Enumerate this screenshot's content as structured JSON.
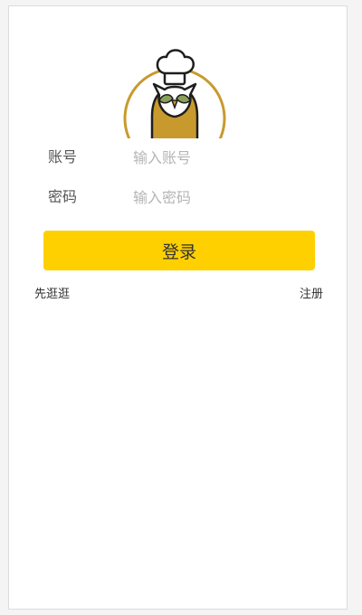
{
  "logo": {
    "icon": "chef-owl-logo",
    "colors": {
      "gold": "#c89a2e",
      "dark": "#1e1e1e",
      "leaf": "#8aa05a"
    }
  },
  "form": {
    "account": {
      "label": "账号",
      "placeholder": "输入账号",
      "value": ""
    },
    "password": {
      "label": "密码",
      "placeholder": "输入密码",
      "value": ""
    }
  },
  "login_button": {
    "label": "登录",
    "color": "#ffd000"
  },
  "links": {
    "browse": "先逛逛",
    "register": "注册"
  }
}
